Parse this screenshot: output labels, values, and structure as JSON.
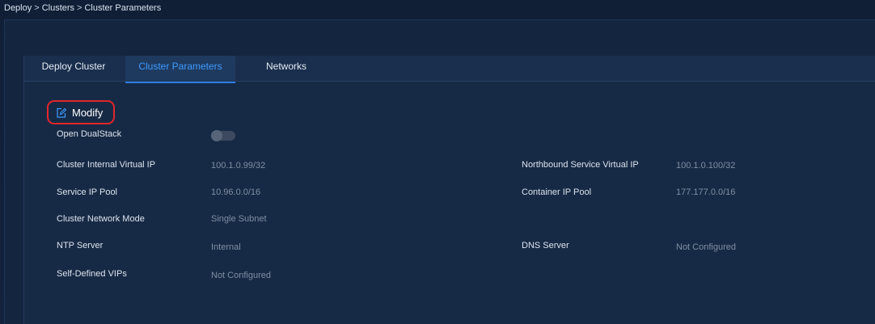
{
  "breadcrumb": {
    "items": [
      "Deploy",
      "Clusters",
      "Cluster Parameters"
    ],
    "separator": ">"
  },
  "tabs": [
    {
      "label": "Deploy Cluster",
      "active": false
    },
    {
      "label": "Cluster Parameters",
      "active": true
    },
    {
      "label": "Networks",
      "active": false
    }
  ],
  "modify": {
    "label": "Modify",
    "icon": "edit-icon"
  },
  "dualstack": {
    "label": "Open DualStack",
    "enabled": false
  },
  "fields": {
    "cluster_internal_vip": {
      "label": "Cluster Internal Virtual IP",
      "value": "100.1.0.99/32"
    },
    "northbound_vip": {
      "label": "Northbound Service Virtual IP",
      "value": "100.1.0.100/32"
    },
    "service_ip_pool": {
      "label": "Service IP Pool",
      "value": "10.96.0.0/16"
    },
    "container_ip_pool": {
      "label": "Container IP Pool",
      "value": "177.177.0.0/16"
    },
    "network_mode": {
      "label": "Cluster Network Mode",
      "value": "Single Subnet"
    },
    "ntp_server": {
      "label": "NTP Server",
      "value": "Internal"
    },
    "dns_server": {
      "label": "DNS Server",
      "value": "Not Configured"
    },
    "self_defined_vips": {
      "label": "Self-Defined VIPs",
      "value": "Not Configured"
    }
  },
  "colors": {
    "accent": "#3d9bff",
    "highlight_border": "#e0262b",
    "background": "#172a45"
  }
}
